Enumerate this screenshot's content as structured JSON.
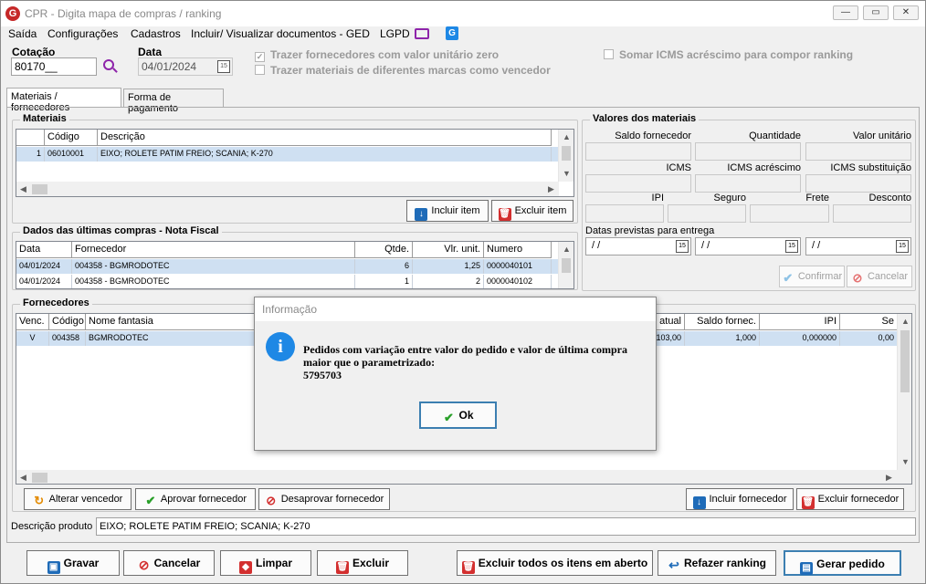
{
  "window": {
    "title": "CPR - Digita mapa de compras / ranking",
    "logo_letter": "G"
  },
  "menu": {
    "items": [
      "Saída",
      "Configurações",
      "Cadastros",
      "Incluir/ Visualizar documentos - GED",
      "LGPD"
    ]
  },
  "header": {
    "cotacao_label": "Cotação",
    "cotacao_value": "80170__",
    "data_label": "Data",
    "data_value": "04/01/2024",
    "chk_zero": "Trazer fornecedores com valor unitário zero",
    "chk_marcas": "Trazer materiais de diferentes marcas como vencedor",
    "chk_icms": "Somar ICMS acréscimo para compor ranking",
    "calendar_day": "15"
  },
  "tabs": [
    "Materiais / fornecedores",
    "Forma de pagamento"
  ],
  "materiais": {
    "title": "Materiais",
    "columns": [
      "Código",
      "Descrição"
    ],
    "rows": [
      {
        "n": "1",
        "codigo": "06010001",
        "descricao": "EIXO; ROLETE PATIM FREIO; SCANIA; K-270"
      }
    ],
    "incluir": "Incluir item",
    "excluir": "Excluir item"
  },
  "ultimas": {
    "title": "Dados das últimas compras - Nota Fiscal",
    "columns": [
      "Data",
      "Fornecedor",
      "Qtde.",
      "Vlr. unit.",
      "Numero"
    ],
    "rows": [
      {
        "data": "04/01/2024",
        "fornecedor": "004358 - BGMRODOTEC",
        "qtde": "6",
        "vlr": "1,25",
        "numero": "0000040101"
      },
      {
        "data": "04/01/2024",
        "fornecedor": "004358 - BGMRODOTEC",
        "qtde": "1",
        "vlr": "2",
        "numero": "0000040102"
      }
    ]
  },
  "valores": {
    "title": "Valores dos materiais",
    "saldo": "Saldo fornecedor",
    "quantidade": "Quantidade",
    "valor_unit": "Valor unitário",
    "icms": "ICMS",
    "icms_acr": "ICMS acréscimo",
    "icms_sub": "ICMS substituição",
    "ipi": "IPI",
    "seguro": "Seguro",
    "frete": "Frete",
    "desconto": "Desconto",
    "datas": "Datas previstas para entrega",
    "date_empty": "/ /",
    "confirmar": "Confirmar",
    "cancelar": "Cancelar"
  },
  "fornecedores": {
    "title": "Fornecedores",
    "columns": [
      "Venc.",
      "Código",
      "Nome fantasia",
      "atual",
      "Saldo fornec.",
      "IPI",
      "Se"
    ],
    "rows": [
      {
        "venc": "V",
        "codigo": "004358",
        "nome": "BGMRODOTEC",
        "atual": "103,00",
        "saldo": "1,000",
        "ipi": "0,000000",
        "se": "0,00"
      }
    ],
    "alterar": "Alterar vencedor",
    "aprovar": "Aprovar fornecedor",
    "desaprovar": "Desaprovar fornecedor",
    "incluir": "Incluir fornecedor",
    "excluir": "Excluir fornecedor"
  },
  "descricao": {
    "label": "Descrição produto",
    "value": "EIXO; ROLETE PATIM FREIO; SCANIA; K-270"
  },
  "footer": {
    "gravar": "Gravar",
    "cancelar": "Cancelar",
    "limpar": "Limpar",
    "excluir": "Excluir",
    "excluir_todos": "Excluir todos os itens em aberto",
    "refazer": "Refazer ranking",
    "gerar": "Gerar pedido"
  },
  "dialog": {
    "title": "Informação",
    "line1": "Pedidos com variação entre valor do pedido e valor de última compra",
    "line2": "maior que o parametrizado:",
    "line3": "5795703",
    "ok": "Ok"
  }
}
